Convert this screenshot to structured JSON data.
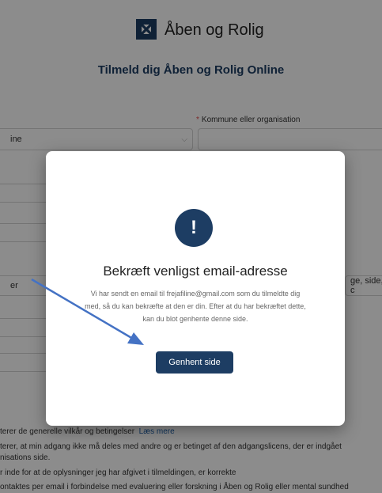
{
  "header": {
    "brand": "Åben og Rolig"
  },
  "form": {
    "title": "Tilmeld dig Åben og Rolig Online",
    "municipality_label": "Kommune eller organisation",
    "select_value_partial": "ine",
    "field_value_partial": "er",
    "field_value_right_partial": "ge, side, c"
  },
  "terms": {
    "line1": "terer de generelle vilkår og betingelser",
    "line1_link": "Læs mere",
    "line2a": "terer, at min adgang ikke må deles med andre og er betinget af den adgangslicens, der er indgået",
    "line2b": "nisations side.",
    "line3": "r inde for at de oplysninger jeg har afgivet i tilmeldingen, er korrekte",
    "line4": "ontaktes per email i forbindelse med evaluering eller forskning i Åben og Rolig eller mental sundhed"
  },
  "modal": {
    "icon": "exclamation-icon",
    "icon_glyph": "!",
    "title": "Bekræft venligst email-adresse",
    "body": "Vi har sendt en email til frejafiline@gmail.com som du tilmeldte dig med, så du kan bekræfte at den er din. Efter at du har bekræftet dette, kan du blot genhente denne side.",
    "button_label": "Genhent side"
  },
  "colors": {
    "brand_navy": "#1d3d63",
    "annotation_arrow": "#4472c4",
    "required_star": "#e24b4b"
  }
}
